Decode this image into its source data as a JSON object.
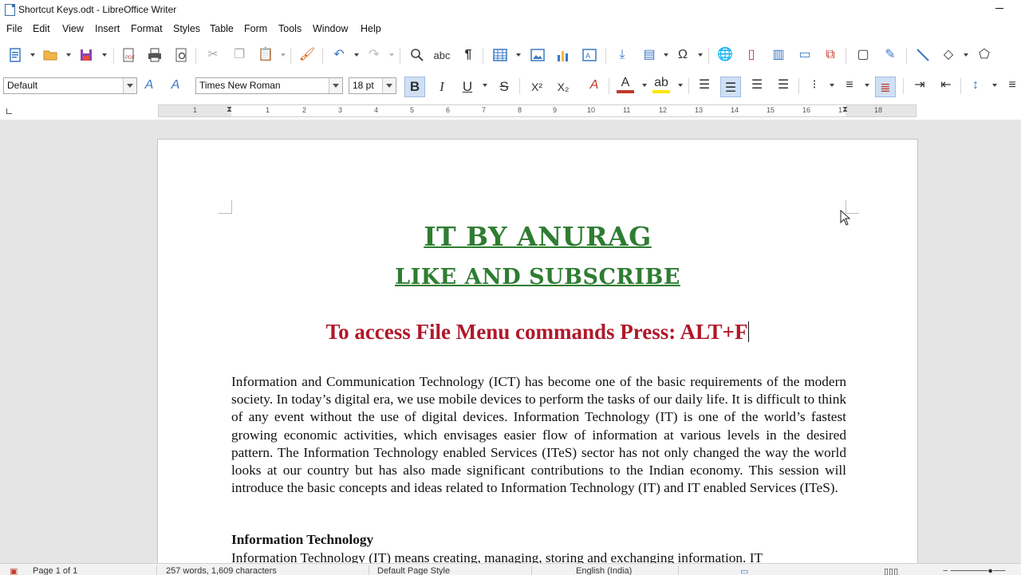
{
  "window": {
    "title": "Shortcut Keys.odt - LibreOffice Writer"
  },
  "menu": [
    "File",
    "Edit",
    "View",
    "Insert",
    "Format",
    "Styles",
    "Table",
    "Form",
    "Tools",
    "Window",
    "Help"
  ],
  "toolbar": {
    "paragraph_style": "Default",
    "font_name": "Times New Roman",
    "font_size": "18 pt",
    "bold_label": "B",
    "italic_label": "I",
    "underline_label": "U",
    "strike_label": "S",
    "superscript_label": "X²",
    "subscript_label": "X₂"
  },
  "ruler": {
    "numbers": [
      "1",
      "2",
      "3",
      "4",
      "5",
      "6",
      "7",
      "8",
      "9",
      "10",
      "11",
      "12",
      "13",
      "14",
      "15",
      "16",
      "17",
      "18"
    ]
  },
  "document": {
    "heading1": "IT BY ANURAG",
    "heading2": "LIKE AND SUBSCRIBE",
    "heading3": "To access File Menu commands Press: ALT+F",
    "paragraph1": "Information and Communication Technology (ICT) has become one of the basic requirements of the modern society. In today’s digital era, we use mobile devices to perform the tasks of our daily life. It is difficult to think of any event without the use of digital devices. Information Technology (IT) is one of the world’s fastest growing economic activities, which envisages easier flow of information at various levels in the desired pattern. The Information Technology enabled Services (ITeS) sector has not only changed the way the world looks at our country but has also made significant contributions to the Indian economy. This session will introduce the basic concepts and ideas related to Information Technology (IT) and IT enabled Services (ITeS).",
    "subheading": "Information Technology",
    "paragraph2": "Information Technology (IT) means creating, managing, storing and exchanging information. IT"
  },
  "status": {
    "page": "Page 1 of 1",
    "words": "257 words, 1,609 characters",
    "page_style": "Default Page Style",
    "language": "English (India)"
  },
  "colors": {
    "heading_green": "#2e7d32",
    "heading_red": "#b0182a",
    "active_button": "#cfe0f4"
  }
}
